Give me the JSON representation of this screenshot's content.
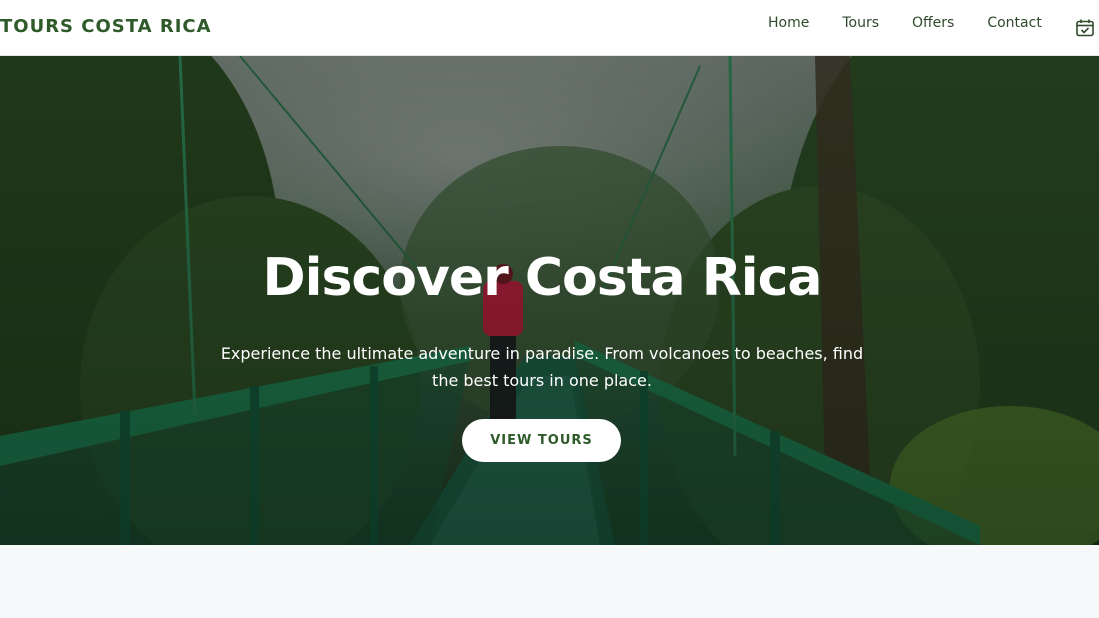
{
  "header": {
    "brand": "TOURS COSTA RICA",
    "nav": [
      {
        "label": "Home"
      },
      {
        "label": "Tours"
      },
      {
        "label": "Offers"
      },
      {
        "label": "Contact"
      }
    ],
    "calendar_icon": "calendar-check-icon"
  },
  "hero": {
    "title": "Discover Costa Rica",
    "subtitle_line1": "Experience the ultimate adventure in paradise. From volcanoes to beaches, find",
    "subtitle_line2": "the best tours in one place.",
    "cta_label": "VIEW TOURS"
  },
  "colors": {
    "brand_green": "#2f5a2a",
    "header_bg": "#ffffff",
    "page_bg": "#f7f8fa",
    "bridge_green": "#1e7a4e"
  }
}
